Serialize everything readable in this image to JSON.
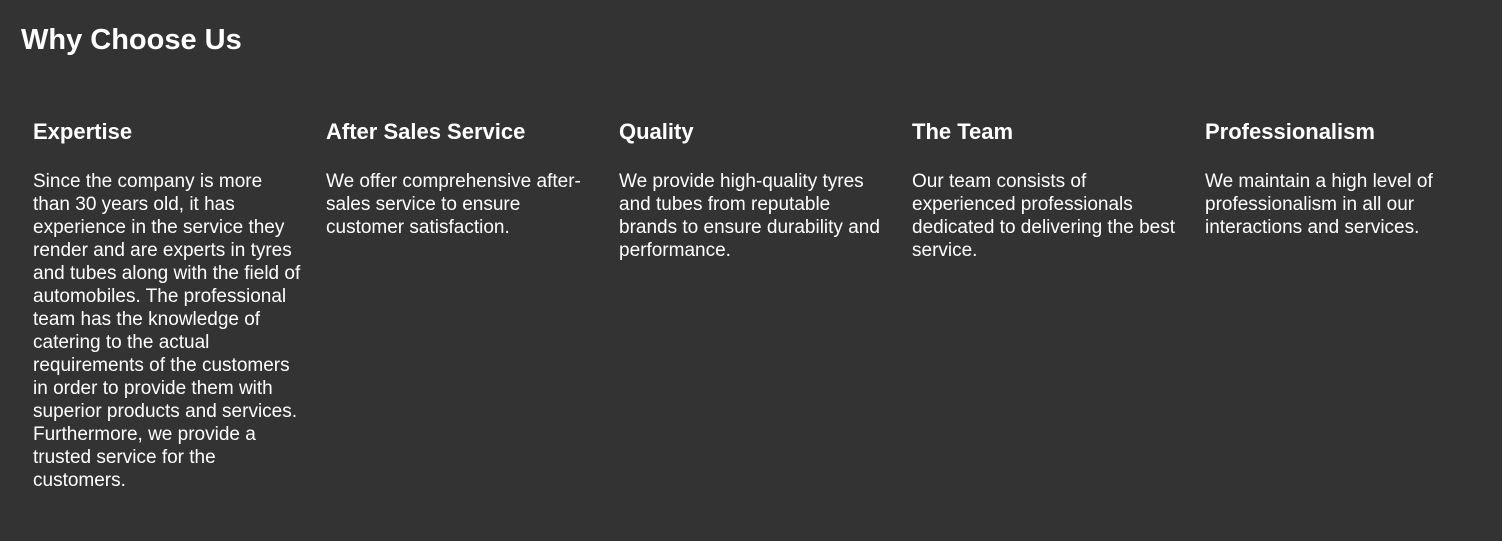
{
  "section": {
    "title": "Why Choose Us",
    "features": [
      {
        "title": "Expertise",
        "text": "Since the company is more than 30 years old, it has experience in the service they render and are experts in tyres and tubes along with the field of automobiles. The professional team has the knowledge of catering to the actual requirements of the customers in order to provide them with superior products and services. Furthermore, we provide a trusted service for the customers."
      },
      {
        "title": "After Sales Service",
        "text": "We offer comprehensive after-sales service to ensure customer satisfaction."
      },
      {
        "title": "Quality",
        "text": "We provide high-quality tyres and tubes from reputable brands to ensure durability and performance."
      },
      {
        "title": "The Team",
        "text": "Our team consists of experienced professionals dedicated to delivering the best service."
      },
      {
        "title": "Professionalism",
        "text": "We maintain a high level of professionalism in all our interactions and services."
      }
    ]
  },
  "colors": {
    "background": "#333333",
    "text": "#ffffff"
  }
}
